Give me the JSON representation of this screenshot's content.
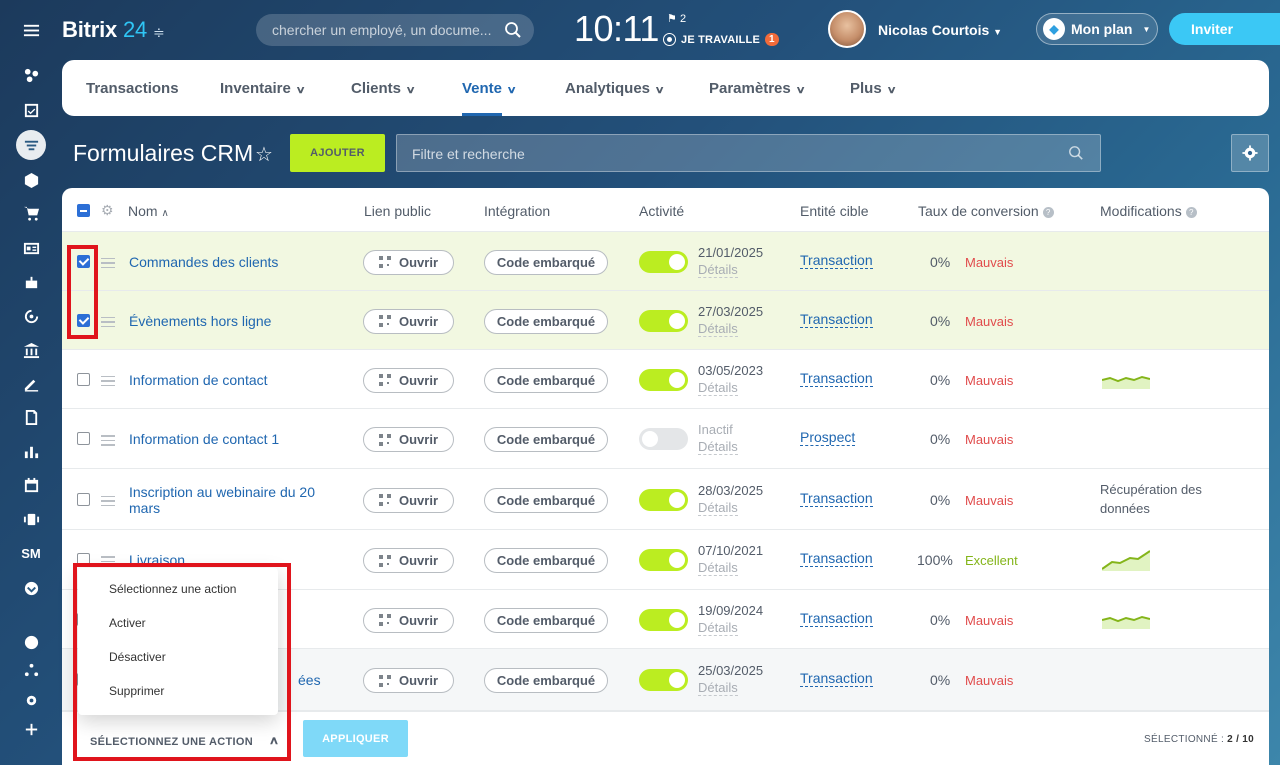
{
  "topbar": {
    "logo_word": "Bitrix",
    "logo_num": "24",
    "search_placeholder": "chercher un employé, un docume...",
    "clock": "10:11",
    "flag_count": "2",
    "work_status": "JE TRAVAILLE",
    "work_badge": "1",
    "user_name": "Nicolas Courtois",
    "plan_label": "Mon plan",
    "invite_label": "Inviter"
  },
  "nav": {
    "items": [
      {
        "label": "Transactions"
      },
      {
        "label": "Inventaire"
      },
      {
        "label": "Clients"
      },
      {
        "label": "Vente"
      },
      {
        "label": "Analytiques"
      },
      {
        "label": "Paramètres"
      },
      {
        "label": "Plus"
      }
    ]
  },
  "rail": {
    "sm_label": "SM"
  },
  "page": {
    "title": "Formulaires CRM",
    "add_label": "AJOUTER",
    "filter_placeholder": "Filtre et recherche"
  },
  "table": {
    "headers": {
      "name": "Nom",
      "public_link": "Lien public",
      "integration": "Intégration",
      "activity": "Activité",
      "entity": "Entité cible",
      "conversion": "Taux de conversion",
      "modifications": "Modifications"
    },
    "open_label": "Ouvrir",
    "embed_label": "Code embarqué",
    "details_label": "Détails",
    "rows": [
      {
        "name": "Commandes des clients",
        "checked": true,
        "active": true,
        "date": "21/01/2025",
        "entity": "Transaction",
        "rate": "0%",
        "quality": "Mauvais",
        "mod": "",
        "spark": ""
      },
      {
        "name": "Évènements hors ligne",
        "checked": true,
        "active": true,
        "date": "27/03/2025",
        "entity": "Transaction",
        "rate": "0%",
        "quality": "Mauvais",
        "mod": "",
        "spark": ""
      },
      {
        "name": "Information de contact",
        "checked": false,
        "active": true,
        "date": "03/05/2023",
        "entity": "Transaction",
        "rate": "0%",
        "quality": "Mauvais",
        "mod": "",
        "spark": "flat"
      },
      {
        "name": "Information de contact 1",
        "checked": false,
        "active": false,
        "date": "Inactif",
        "entity": "Prospect",
        "rate": "0%",
        "quality": "Mauvais",
        "mod": "",
        "spark": ""
      },
      {
        "name": "Inscription au webinaire du 20 mars",
        "checked": false,
        "active": true,
        "date": "28/03/2025",
        "entity": "Transaction",
        "rate": "0%",
        "quality": "Mauvais",
        "mod": "Récupération des données",
        "spark": ""
      },
      {
        "name": "Livraison",
        "checked": false,
        "active": true,
        "date": "07/10/2021",
        "entity": "Transaction",
        "rate": "100%",
        "quality": "Excellent",
        "mod": "",
        "spark": "up"
      },
      {
        "name": "",
        "checked": false,
        "active": true,
        "date": "19/09/2024",
        "entity": "Transaction",
        "rate": "0%",
        "quality": "Mauvais",
        "mod": "",
        "spark": "flat"
      },
      {
        "name": "ées",
        "checked": false,
        "active": true,
        "date": "25/03/2025",
        "entity": "Transaction",
        "rate": "0%",
        "quality": "Mauvais",
        "mod": "",
        "spark": ""
      }
    ]
  },
  "popup": {
    "options": [
      "Sélectionnez une action",
      "Activer",
      "Désactiver",
      "Supprimer"
    ]
  },
  "bottom": {
    "select_action": "SÉLECTIONNEZ UNE ACTION",
    "apply_label": "APPLIQUER",
    "counter_label": "SÉLECTIONNÉ :",
    "counter_value": "2 / 10"
  },
  "colors": {
    "accent": "#2067b0",
    "add_button": "#bbed21",
    "invite": "#3bc8f5",
    "bad": "#e14c4c",
    "good": "#84b51a",
    "highlight": "#e0141c"
  }
}
